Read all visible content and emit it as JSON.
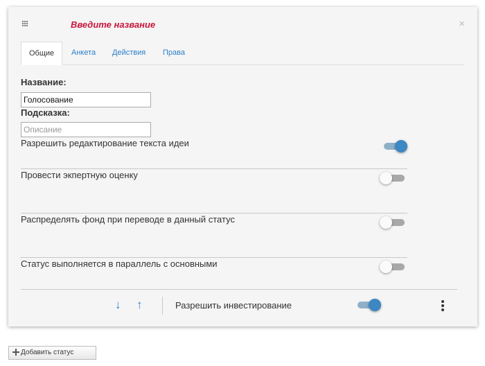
{
  "card": {
    "title": "Введите название",
    "close_glyph": "×"
  },
  "tabs": [
    {
      "label": "Общие",
      "active": true
    },
    {
      "label": "Анкета",
      "active": false
    },
    {
      "label": "Действия",
      "active": false
    },
    {
      "label": "Права",
      "active": false
    }
  ],
  "form": {
    "name_label": "Название:",
    "name_value": "Голосование",
    "hint_label": "Подсказка:",
    "hint_placeholder": "Описание"
  },
  "settings": [
    {
      "label": "Разрешить редактирование текста идеи",
      "enabled": true
    },
    {
      "label": "Провести экпертную оценку",
      "enabled": false
    },
    {
      "label": "Распределять фонд при переводе в данный статус",
      "enabled": false
    },
    {
      "label": "Статус выполняется в параллель с основными",
      "enabled": false
    }
  ],
  "footer": {
    "down_glyph": "↓",
    "up_glyph": "↑",
    "invest_label": "Разрешить инвестирование",
    "invest_enabled": true
  },
  "add_status_label": "Добавить статус",
  "icons": [
    "grid-icon",
    "close-icon",
    "arrow-down-icon",
    "arrow-up-icon",
    "kebab-menu-icon",
    "plus-icon"
  ],
  "colors": {
    "accent": "#2a7fc9",
    "title": "#c8163b",
    "toggle_on": "#3d87c2"
  }
}
